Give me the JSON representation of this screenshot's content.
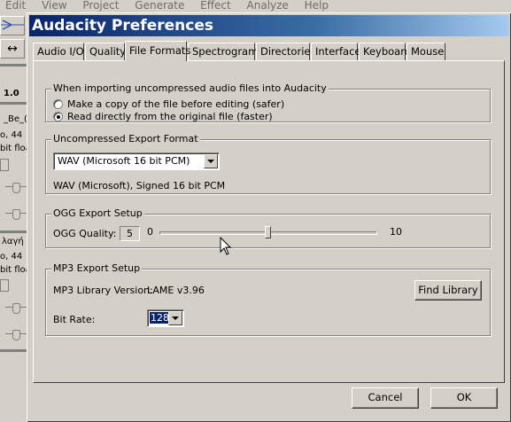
{
  "background_app": {
    "menu": [
      "Edit",
      "View",
      "Project",
      "Generate",
      "Effect",
      "Analyze",
      "Help"
    ],
    "left_panel": {
      "zoom_label": "1.0",
      "track1": {
        "name": "_Be_(",
        "info_line1": "o, 44",
        "info_line2": "bit floa"
      },
      "track2": {
        "name": "λαγή",
        "info_line1": "o, 44",
        "info_line2": "bit floa"
      }
    }
  },
  "dialog": {
    "title": "Audacity Preferences",
    "tabs": [
      {
        "label": "Audio I/O"
      },
      {
        "label": "Quality"
      },
      {
        "label": "File Formats",
        "active": true
      },
      {
        "label": "Spectrograms"
      },
      {
        "label": "Directories"
      },
      {
        "label": "Interface"
      },
      {
        "label": "Keyboard"
      },
      {
        "label": "Mouse"
      }
    ],
    "import_group": {
      "legend": "When importing uncompressed audio files into Audacity",
      "option_copy": "Make a copy of the file before editing (safer)",
      "option_direct": "Read directly from the original file (faster)",
      "selected": "direct"
    },
    "export_group": {
      "legend": "Uncompressed Export Format",
      "format_value": "WAV (Microsoft 16 bit PCM)",
      "description": "WAV (Microsoft), Signed 16 bit PCM"
    },
    "ogg_group": {
      "legend": "OGG Export Setup",
      "quality_label": "OGG Quality:",
      "quality_value": "5",
      "slider_min_label": "0",
      "slider_max_label": "10",
      "slider_value": 5
    },
    "mp3_group": {
      "legend": "MP3 Export Setup",
      "library_label": "MP3 Library Version:",
      "library_value": "LAME v3.96",
      "find_library_button": "Find Library",
      "bitrate_label": "Bit Rate:",
      "bitrate_value": "128"
    },
    "buttons": {
      "cancel": "Cancel",
      "ok": "OK"
    }
  }
}
